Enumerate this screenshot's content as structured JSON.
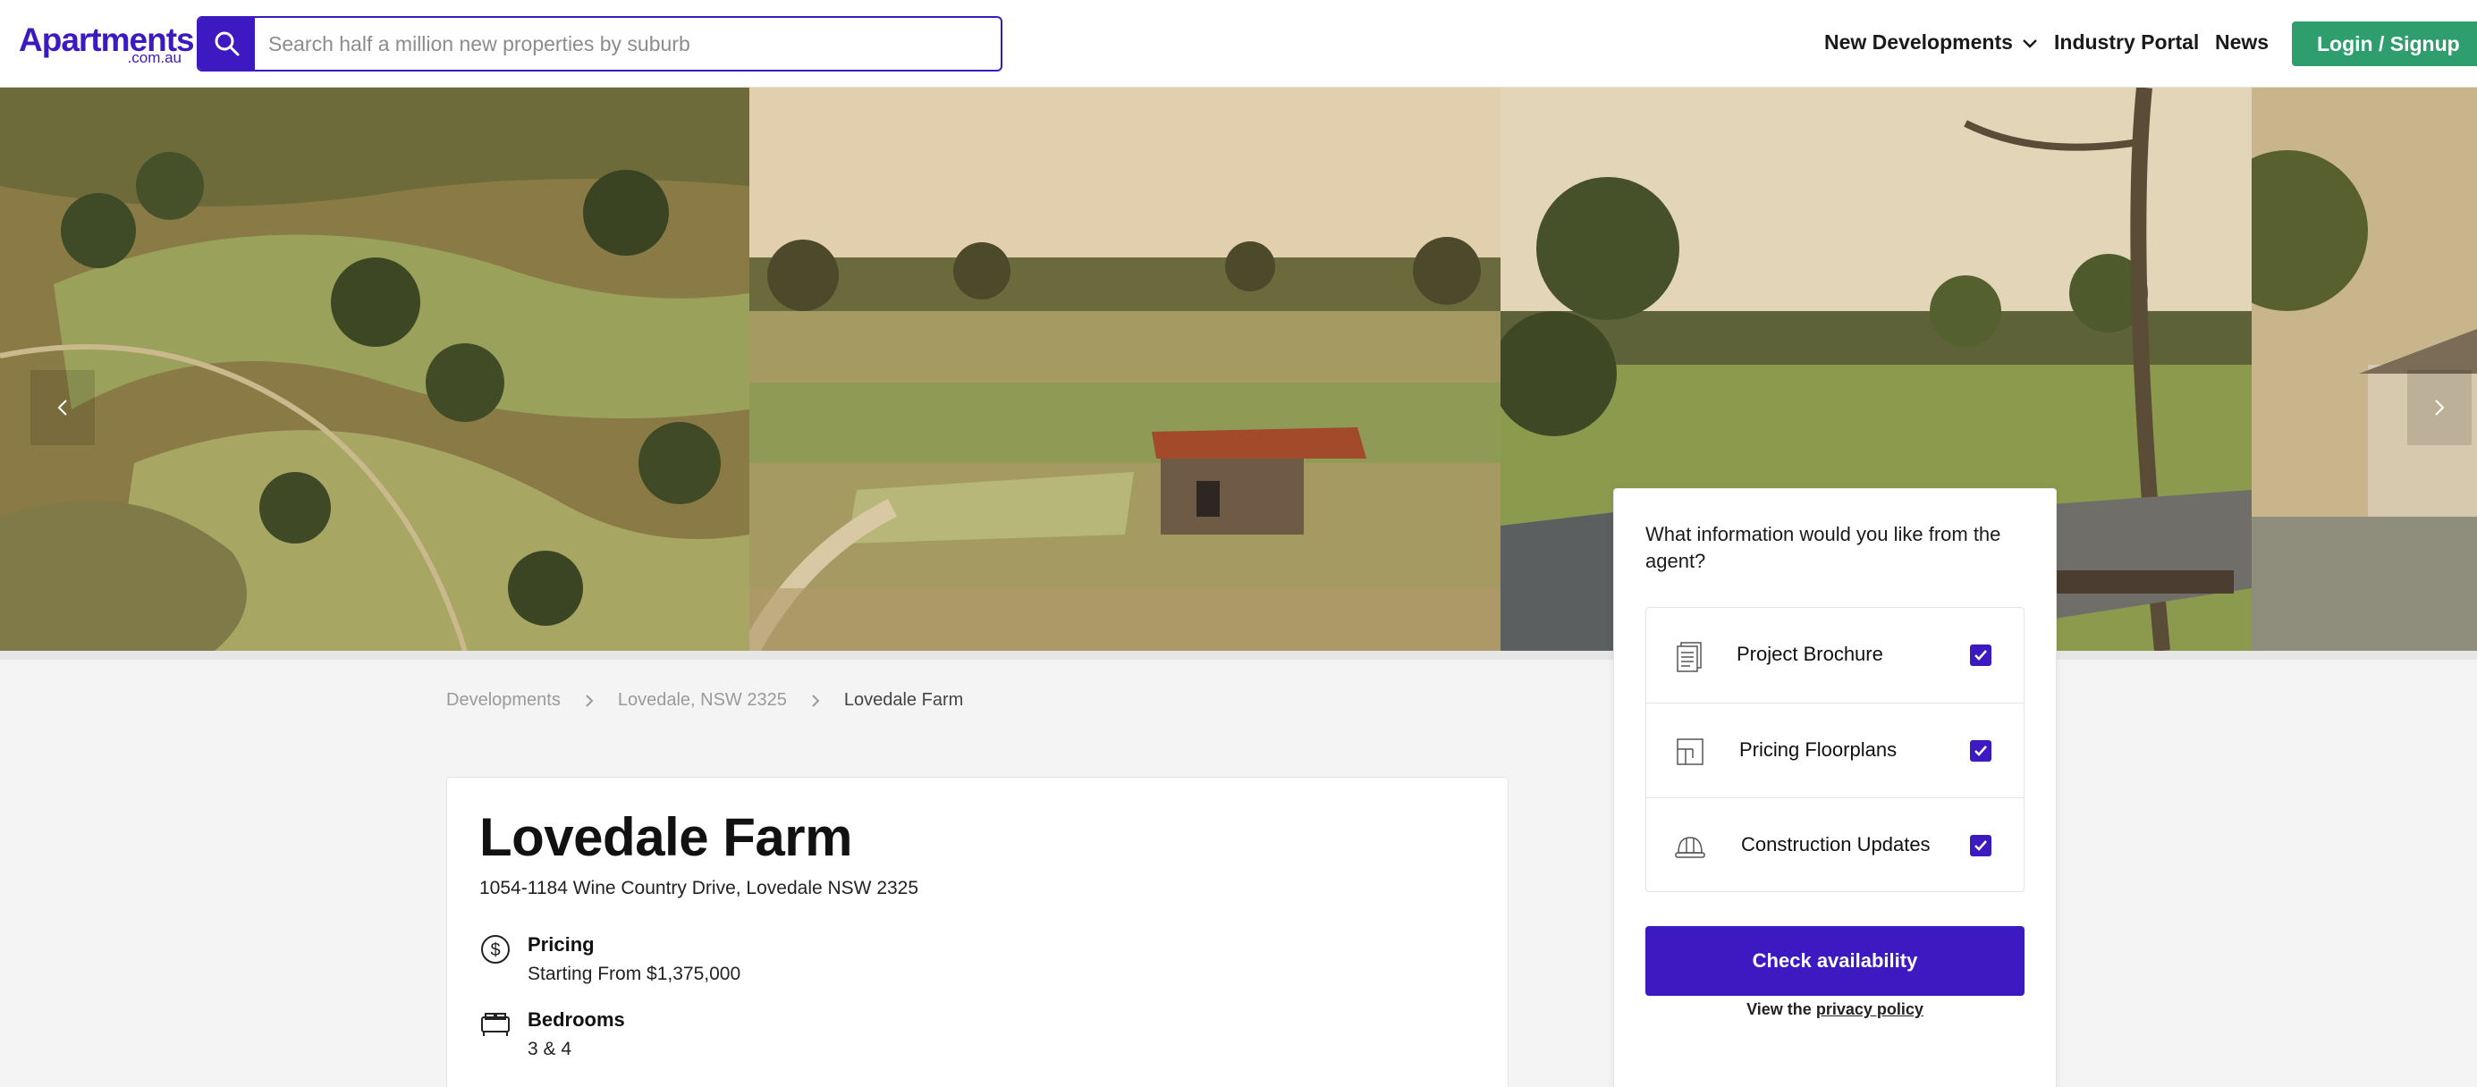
{
  "brand": {
    "logo_main": "Apartments",
    "logo_sub": ".com.au",
    "primary_color": "#3d19c2",
    "accent_color": "#2e9e6e"
  },
  "search": {
    "icon": "search-icon",
    "placeholder": "Search half a million new properties by suburb",
    "value": ""
  },
  "nav": {
    "new_developments": "New Developments",
    "industry_portal": "Industry Portal",
    "news": "News",
    "login": "Login / Signup"
  },
  "gallery": {
    "photos": [
      "aerial-golf-course-photo",
      "rustic-cabin-fairway-photo",
      "outdoor-lounge-fairway-photo",
      "house-street-photo"
    ],
    "prev_icon": "chevron-left-icon",
    "next_icon": "chevron-right-icon"
  },
  "breadcrumb": {
    "items": [
      "Developments",
      "Lovedale, NSW 2325",
      "Lovedale Farm"
    ]
  },
  "listing": {
    "title": "Lovedale Farm",
    "address": "1054-1184 Wine Country Drive, Lovedale NSW 2325",
    "features": [
      {
        "icon": "dollar-icon",
        "label": "Pricing",
        "value": "Starting From $1,375,000"
      },
      {
        "icon": "bed-icon",
        "label": "Bedrooms",
        "value": "3 & 4"
      }
    ]
  },
  "enquiry": {
    "question": "What information would you like from the agent?",
    "options": [
      {
        "icon": "brochure-icon",
        "label": "Project Brochure",
        "checked": true
      },
      {
        "icon": "floorplan-icon",
        "label": "Pricing Floorplans",
        "checked": true
      },
      {
        "icon": "hard-hat-icon",
        "label": "Construction Updates",
        "checked": true
      }
    ],
    "cta": "Check availability",
    "privacy_prefix": "View the",
    "privacy_link": "privacy policy"
  }
}
